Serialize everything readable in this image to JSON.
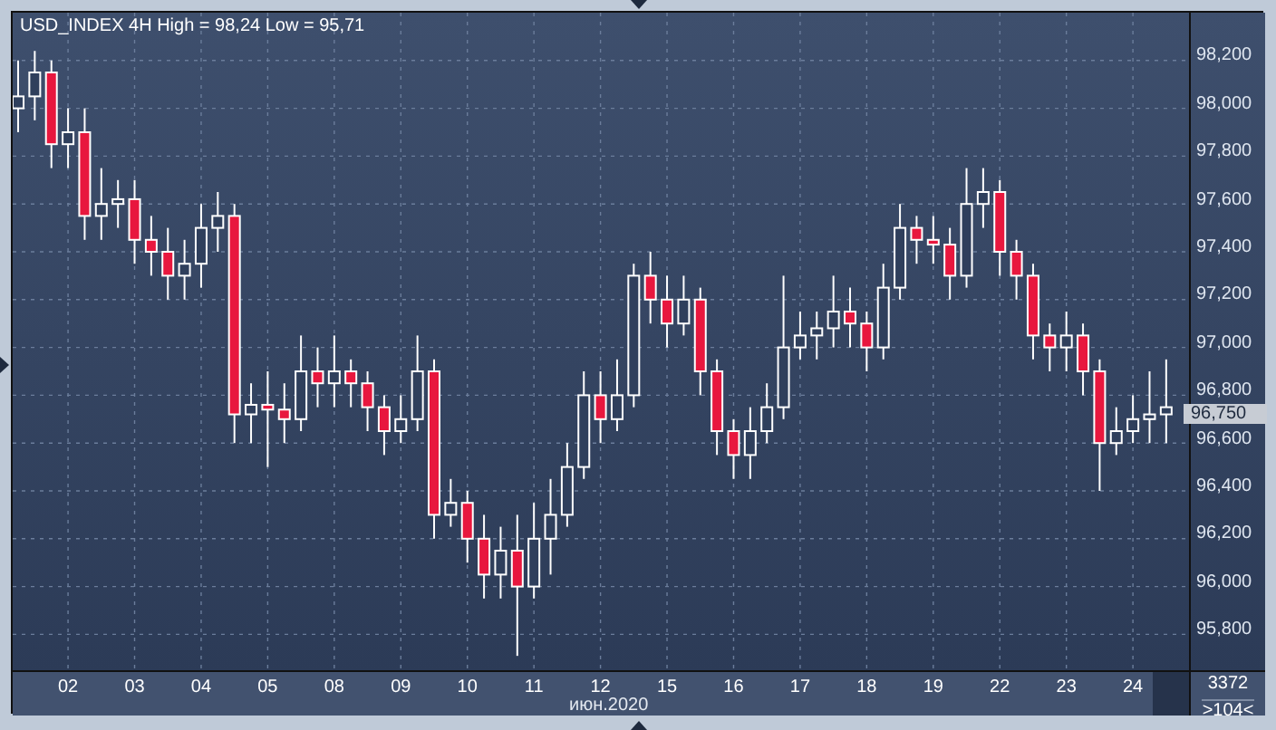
{
  "chart": {
    "title": "USD_INDEX 4H High = 98,24 Low = 95,71",
    "last_price": "96,750",
    "month_label": "июн.2020",
    "corner": {
      "count": "3372",
      "range": ">104<"
    },
    "chart_data": {
      "type": "candlestick",
      "grid": true,
      "ylim": [
        95650,
        98400
      ],
      "yticks": [
        {
          "value": 98200,
          "label": "98,200"
        },
        {
          "value": 98000,
          "label": "98,000"
        },
        {
          "value": 97800,
          "label": "97,800"
        },
        {
          "value": 97600,
          "label": "97,600"
        },
        {
          "value": 97400,
          "label": "97,400"
        },
        {
          "value": 97200,
          "label": "97,200"
        },
        {
          "value": 97000,
          "label": "97,000"
        },
        {
          "value": 96800,
          "label": "96,800"
        },
        {
          "value": 96600,
          "label": "96,600"
        },
        {
          "value": 96400,
          "label": "96,400"
        },
        {
          "value": 96200,
          "label": "96,200"
        },
        {
          "value": 96000,
          "label": "96,000"
        },
        {
          "value": 95800,
          "label": "95,800"
        }
      ],
      "categories": [
        null,
        null,
        null,
        "02",
        null,
        null,
        null,
        "03",
        null,
        null,
        null,
        "04",
        null,
        null,
        null,
        "05",
        null,
        null,
        null,
        "08",
        null,
        null,
        null,
        "09",
        null,
        null,
        null,
        "10",
        null,
        null,
        null,
        "11",
        null,
        null,
        null,
        "12",
        null,
        null,
        null,
        "15",
        null,
        null,
        null,
        "16",
        null,
        null,
        null,
        "17",
        null,
        null,
        null,
        "18",
        null,
        null,
        null,
        "19",
        null,
        null,
        null,
        "22",
        null,
        null,
        null,
        "23",
        null,
        null,
        null,
        "24",
        null,
        null
      ],
      "ohlc": [
        [
          98000,
          98200,
          97900,
          98050
        ],
        [
          98050,
          98240,
          97950,
          98150
        ],
        [
          98150,
          98200,
          97750,
          97850
        ],
        [
          97850,
          98000,
          97750,
          97900
        ],
        [
          97900,
          98000,
          97450,
          97550
        ],
        [
          97550,
          97750,
          97450,
          97600
        ],
        [
          97600,
          97700,
          97500,
          97620
        ],
        [
          97620,
          97700,
          97350,
          97450
        ],
        [
          97450,
          97550,
          97300,
          97400
        ],
        [
          97400,
          97500,
          97200,
          97300
        ],
        [
          97300,
          97450,
          97200,
          97350
        ],
        [
          97350,
          97600,
          97250,
          97500
        ],
        [
          97500,
          97650,
          97400,
          97550
        ],
        [
          97550,
          97600,
          96600,
          96720
        ],
        [
          96720,
          96850,
          96600,
          96760
        ],
        [
          96760,
          96900,
          96500,
          96740
        ],
        [
          96740,
          96850,
          96600,
          96700
        ],
        [
          96700,
          97050,
          96650,
          96900
        ],
        [
          96900,
          97000,
          96750,
          96850
        ],
        [
          96850,
          97050,
          96750,
          96900
        ],
        [
          96900,
          96950,
          96750,
          96850
        ],
        [
          96850,
          96900,
          96650,
          96750
        ],
        [
          96750,
          96800,
          96550,
          96650
        ],
        [
          96650,
          96800,
          96600,
          96700
        ],
        [
          96700,
          97050,
          96650,
          96900
        ],
        [
          96900,
          96950,
          96200,
          96300
        ],
        [
          96300,
          96450,
          96250,
          96350
        ],
        [
          96350,
          96400,
          96100,
          96200
        ],
        [
          96200,
          96300,
          95950,
          96050
        ],
        [
          96050,
          96250,
          95950,
          96150
        ],
        [
          96150,
          96300,
          95710,
          96000
        ],
        [
          96000,
          96350,
          95950,
          96200
        ],
        [
          96200,
          96450,
          96050,
          96300
        ],
        [
          96300,
          96600,
          96250,
          96500
        ],
        [
          96500,
          96900,
          96450,
          96800
        ],
        [
          96800,
          96900,
          96600,
          96700
        ],
        [
          96700,
          96950,
          96650,
          96800
        ],
        [
          96800,
          97350,
          96750,
          97300
        ],
        [
          97300,
          97400,
          97100,
          97200
        ],
        [
          97200,
          97300,
          97000,
          97100
        ],
        [
          97100,
          97300,
          97050,
          97200
        ],
        [
          97200,
          97250,
          96800,
          96900
        ],
        [
          96900,
          96950,
          96550,
          96650
        ],
        [
          96650,
          96700,
          96450,
          96550
        ],
        [
          96550,
          96750,
          96450,
          96650
        ],
        [
          96650,
          96850,
          96600,
          96750
        ],
        [
          96750,
          97300,
          96700,
          97000
        ],
        [
          97000,
          97150,
          96950,
          97050
        ],
        [
          97050,
          97150,
          96950,
          97080
        ],
        [
          97080,
          97300,
          97000,
          97150
        ],
        [
          97150,
          97250,
          97000,
          97100
        ],
        [
          97100,
          97150,
          96900,
          97000
        ],
        [
          97000,
          97350,
          96950,
          97250
        ],
        [
          97250,
          97600,
          97200,
          97500
        ],
        [
          97500,
          97550,
          97350,
          97450
        ],
        [
          97450,
          97550,
          97350,
          97430
        ],
        [
          97430,
          97500,
          97200,
          97300
        ],
        [
          97300,
          97750,
          97250,
          97600
        ],
        [
          97600,
          97750,
          97500,
          97650
        ],
        [
          97650,
          97700,
          97300,
          97400
        ],
        [
          97400,
          97450,
          97200,
          97300
        ],
        [
          97300,
          97350,
          96950,
          97050
        ],
        [
          97050,
          97100,
          96900,
          97000
        ],
        [
          97000,
          97150,
          96900,
          97050
        ],
        [
          97050,
          97100,
          96800,
          96900
        ],
        [
          96900,
          96950,
          96400,
          96600
        ],
        [
          96600,
          96750,
          96550,
          96650
        ],
        [
          96650,
          96800,
          96600,
          96700
        ],
        [
          96700,
          96900,
          96600,
          96720
        ],
        [
          96720,
          96950,
          96600,
          96750
        ]
      ]
    }
  }
}
